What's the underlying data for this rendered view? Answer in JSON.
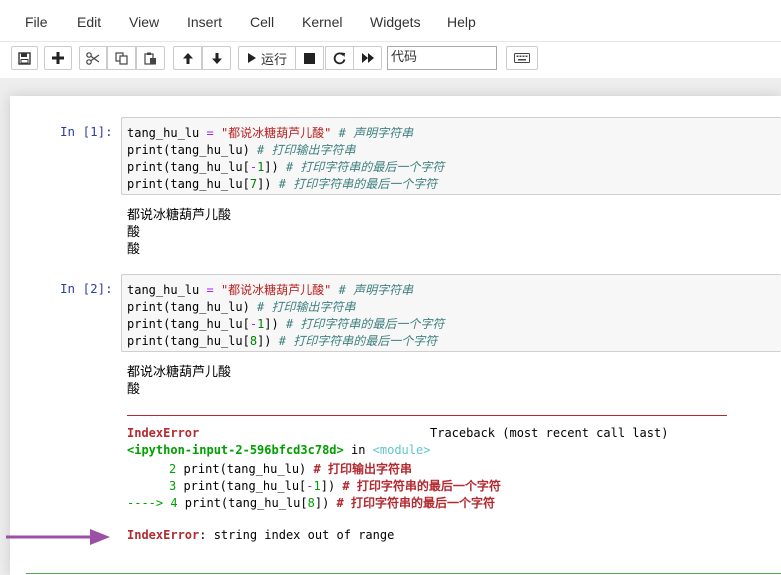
{
  "menu": [
    "File",
    "Edit",
    "View",
    "Insert",
    "Cell",
    "Kernel",
    "Widgets",
    "Help"
  ],
  "toolbar": {
    "run_label": "运行",
    "cell_type": "代码"
  },
  "icons": {
    "save": "save-icon",
    "add": "plus-icon",
    "cut": "scissors-icon",
    "copy": "copy-icon",
    "paste": "paste-icon",
    "up": "arrow-up-icon",
    "down": "arrow-down-icon",
    "run": "play-icon",
    "stop": "stop-icon",
    "restart": "restart-icon",
    "run_all": "fast-forward-icon",
    "keyboard": "keyboard-icon"
  },
  "cells": [
    {
      "prompt": "In  [1]:",
      "code": {
        "l1": {
          "var": "tang_hu_lu",
          "op": " = ",
          "str": "\"都说冰糖葫芦儿酸\"",
          "com": " # 声明字符串"
        },
        "l2": {
          "a": "print(tang_hu_lu)",
          "com": " # 打印输出字符串"
        },
        "l3": {
          "a": "print(tang_hu_lu[",
          "op": "-",
          "num": "1",
          "b": "])",
          "com": " # 打印字符串的最后一个字符"
        },
        "l4": {
          "a": "print(tang_hu_lu[",
          "num": "7",
          "b": "])",
          "com": " # 打印字符串的最后一个字符"
        }
      },
      "output": [
        "都说冰糖葫芦儿酸",
        "酸",
        "酸"
      ]
    },
    {
      "prompt": "In  [2]:",
      "code": {
        "l1": {
          "var": "tang_hu_lu",
          "op": " = ",
          "str": "\"都说冰糖葫芦儿酸\"",
          "com": " # 声明字符串"
        },
        "l2": {
          "a": "print(tang_hu_lu)",
          "com": " # 打印输出字符串"
        },
        "l3": {
          "a": "print(tang_hu_lu[",
          "op": "-",
          "num": "1",
          "b": "])",
          "com": " # 打印字符串的最后一个字符"
        },
        "l4": {
          "a": "print(tang_hu_lu[",
          "num": "8",
          "b": "])",
          "com": " # 打印字符串的最后一个字符"
        }
      },
      "output": [
        "都说冰糖葫芦儿酸",
        "酸"
      ],
      "traceback": {
        "error_name": "IndexError",
        "header_right": "Traceback (most recent call last)",
        "location_file": "<ipython-input-2-596bfcd3c78d>",
        "location_in": " in ",
        "location_module": "<module>",
        "frames": [
          {
            "num": "2",
            "code": " print(tang_hu_lu)",
            "com": " # 打印输出字符串"
          },
          {
            "num": "3",
            "code": " print(tang_hu_lu[",
            "op": "-",
            "n": "1",
            "end": "])",
            "com": " # 打印字符串的最后一个字符"
          },
          {
            "arrow": "---->",
            "num": " 4",
            "code": " print(tang_hu_lu[",
            "n": "8",
            "end": "])",
            "com": " # 打印字符串的最后一个字符"
          }
        ],
        "final_name": "IndexError",
        "final_msg": ": string index out of range"
      }
    }
  ],
  "colors": {
    "annotation_arrow": "#9b4fa5",
    "error": "#b22b31",
    "prompt": "#303f9f"
  }
}
